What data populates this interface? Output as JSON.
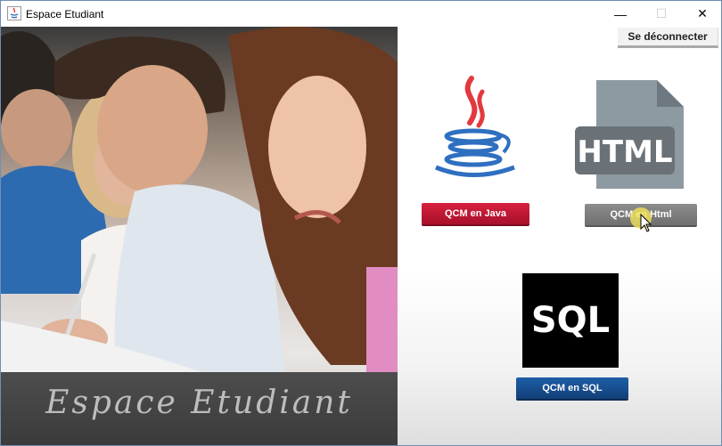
{
  "window": {
    "title": "Espace Etudiant"
  },
  "controls": {
    "minimize": "—",
    "maximize": "☐",
    "close": "✕"
  },
  "header": {
    "logout_label": "Se déconnecter"
  },
  "photo": {
    "caption": "Espace Etudiant"
  },
  "quizzes": [
    {
      "label": "QCM en Java",
      "color": "#c4162f"
    },
    {
      "label": "QCM en Html",
      "color": "#7f7f7f"
    },
    {
      "label": "QCM en SQL",
      "color": "#174f92"
    }
  ],
  "logos": {
    "html_text": "HTML",
    "sql_text": "SQL"
  }
}
